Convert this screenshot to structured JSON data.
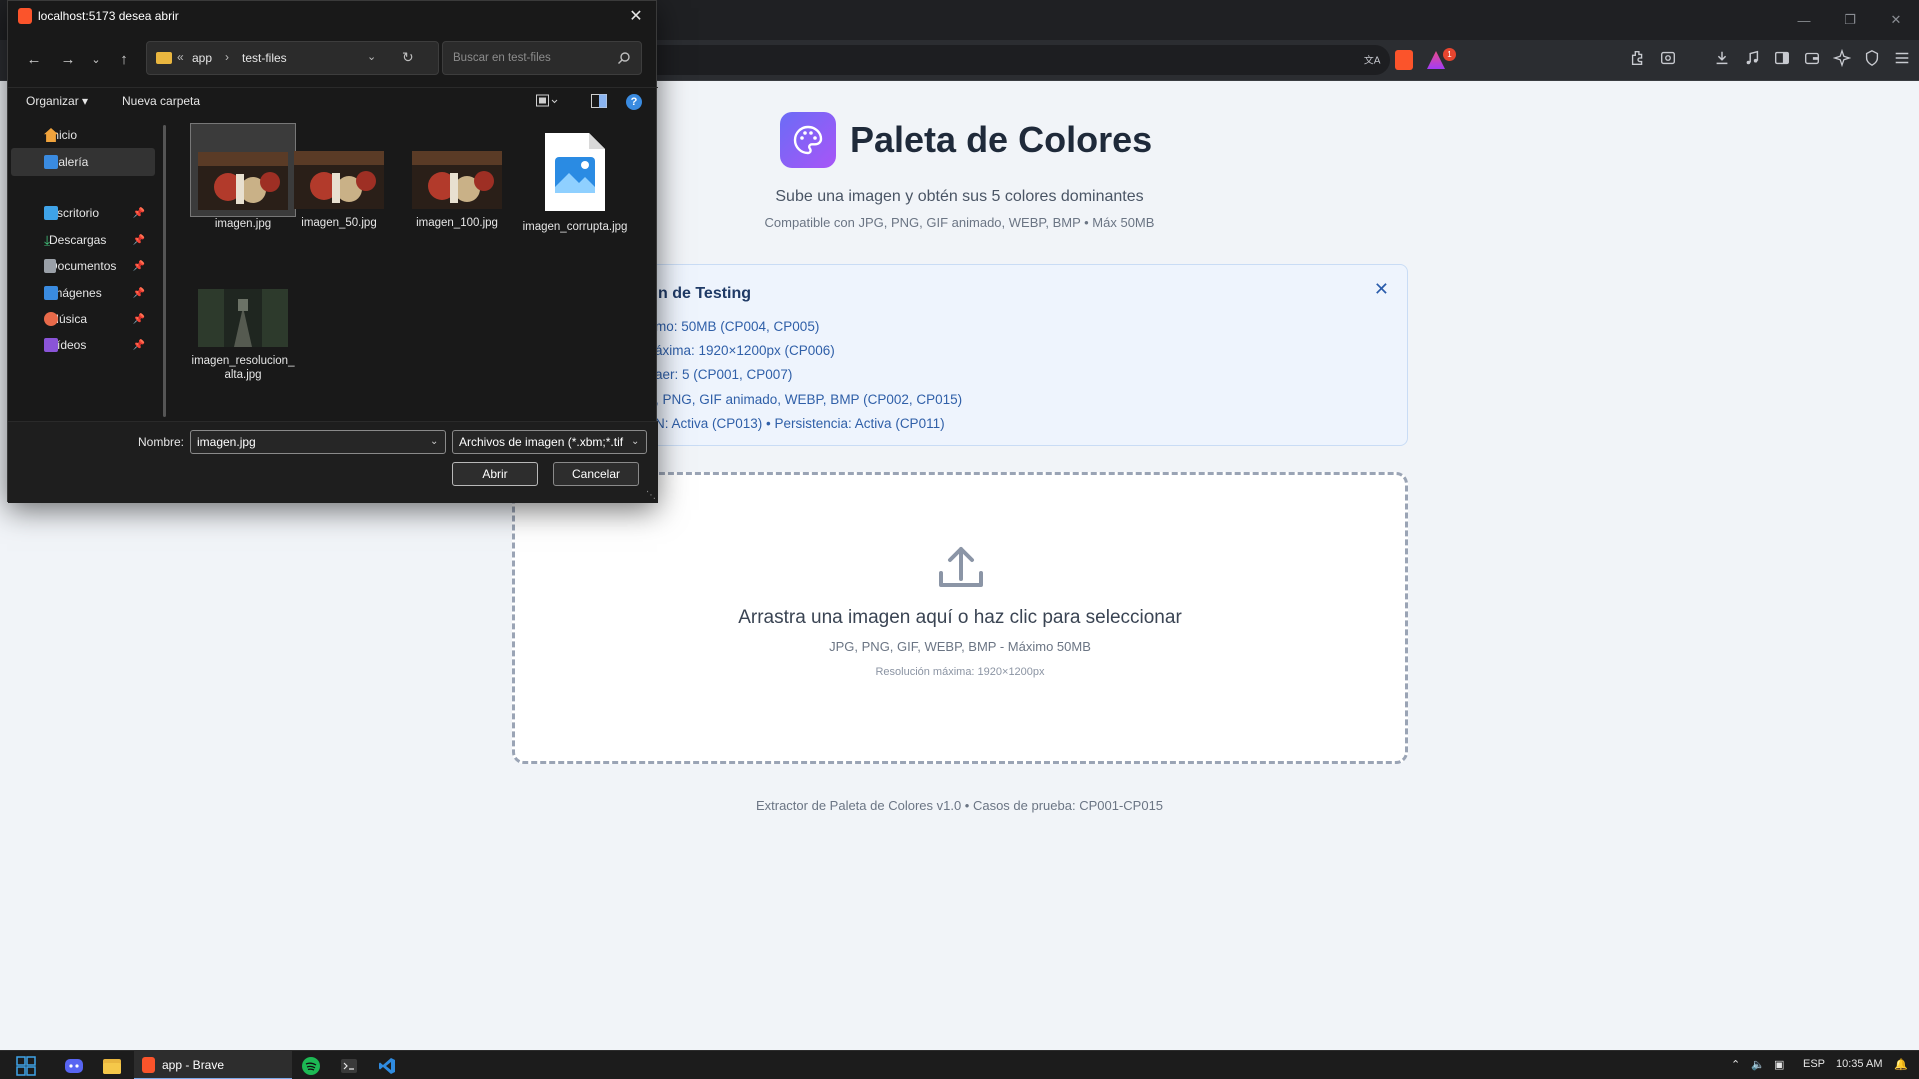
{
  "dialog": {
    "title": "localhost:5173 desea abrir",
    "path_segments": [
      "app",
      "test-files"
    ],
    "search_placeholder": "Buscar en test-files",
    "organize_label": "Organizar",
    "new_folder_label": "Nueva carpeta",
    "sidebar_items": [
      {
        "label": "Inicio",
        "icon": "home-icon",
        "pinned": false
      },
      {
        "label": "Galería",
        "icon": "gallery-icon",
        "pinned": false,
        "selected": true
      },
      {
        "label": "Escritorio",
        "icon": "desktop-icon",
        "pinned": true
      },
      {
        "label": "Descargas",
        "icon": "download-icon",
        "pinned": true
      },
      {
        "label": "Documentos",
        "icon": "documents-icon",
        "pinned": true
      },
      {
        "label": "Imágenes",
        "icon": "pictures-icon",
        "pinned": true
      },
      {
        "label": "Música",
        "icon": "music-icon",
        "pinned": true
      },
      {
        "label": "Vídeos",
        "icon": "videos-icon",
        "pinned": true
      }
    ],
    "files": [
      {
        "name": "imagen.jpg",
        "selected": true
      },
      {
        "name": "imagen_50.jpg"
      },
      {
        "name": "imagen_100.jpg"
      },
      {
        "name": "imagen_corrupta.jpg"
      },
      {
        "name": "imagen_resolucion_alta.jpg"
      }
    ],
    "name_label": "Nombre:",
    "name_value": "imagen.jpg",
    "file_type_value": "Archivos de imagen (*.xbm;*.tif",
    "open_label": "Abrir",
    "cancel_label": "Cancelar"
  },
  "page": {
    "title": "Paleta de Colores",
    "subtitle": "Sube una imagen y obtén sus 5 colores dominantes",
    "compat": "Compatible con JPG, PNG, GIF animado, WEBP, BMP • Máx 50MB",
    "testing_title": "n de Testing",
    "testing_items": [
      "mo: 50MB (CP004, CP005)",
      "áxima: 1920×1200px (CP006)",
      "aer: 5 (CP001, CP007)",
      ", PNG, GIF animado, WEBP, BMP (CP002, CP015)",
      "N: Activa (CP013) • Persistencia: Activa (CP011)"
    ],
    "drop_main": "Arrastra una imagen aquí o haz clic para seleccionar",
    "drop_sub": "JPG, PNG, GIF, WEBP, BMP - Máximo 50MB",
    "drop_res": "Resolución máxima: 1920×1200px",
    "footer": "Extractor de Paleta de Colores v1.0 • Casos de prueba: CP001-CP015"
  },
  "browser": {
    "notification_count": "1"
  },
  "taskbar": {
    "active_app_label": "app - Brave",
    "language": "ESP",
    "time": "10:35 AM"
  },
  "colors": {
    "accent_purple": "#7c5cf6",
    "testing_text": "#2f5fa8",
    "dialog_bg": "#191919"
  }
}
